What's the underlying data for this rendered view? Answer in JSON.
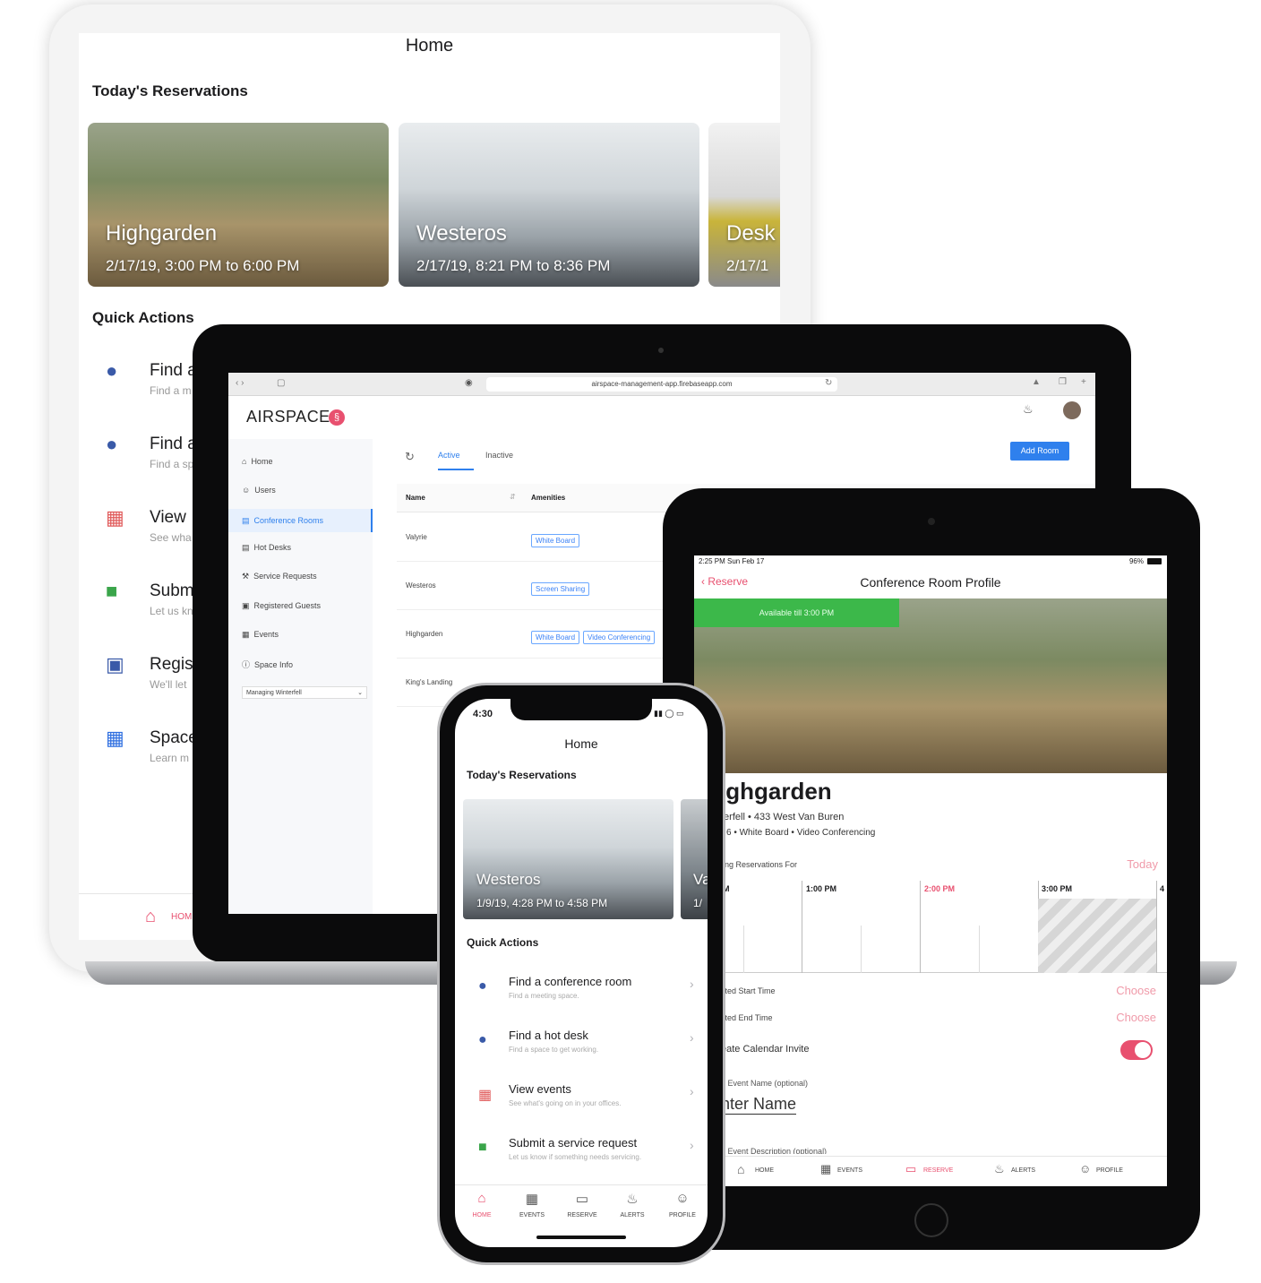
{
  "back_tablet": {
    "title": "Home",
    "reservations_heading": "Today's Reservations",
    "cards": [
      {
        "name": "Highgarden",
        "time": "2/17/19, 3:00 PM to 6:00 PM"
      },
      {
        "name": "Westeros",
        "time": "2/17/19, 8:21 PM to 8:36 PM"
      },
      {
        "name": "Desk",
        "time": "2/17/1"
      }
    ],
    "quick_actions_heading": "Quick Actions",
    "quick_actions": [
      {
        "title": "Find a",
        "sub": "Find a m"
      },
      {
        "title": "Find a",
        "sub": "Find a sp"
      },
      {
        "title": "View",
        "sub": "See wha"
      },
      {
        "title": "Subm",
        "sub": "Let us kn"
      },
      {
        "title": "Regis",
        "sub": "We'll let"
      },
      {
        "title": "Space",
        "sub": "Learn m"
      }
    ],
    "tab_home": "HOM"
  },
  "laptop": {
    "url": "airspace-management-app.firebaseapp.com",
    "logo": "AIRSPACE",
    "nav": [
      "Home",
      "Users",
      "Conference Rooms",
      "Hot Desks",
      "Service Requests",
      "Registered Guests",
      "Events",
      "Space Info"
    ],
    "managing": "Managing Winterfell",
    "tabs": {
      "active": "Active",
      "inactive": "Inactive"
    },
    "add_room": "Add Room",
    "columns": {
      "name": "Name",
      "amenities": "Amenities"
    },
    "rows": [
      {
        "name": "Valyrie",
        "tags": [
          "White Board"
        ]
      },
      {
        "name": "Westeros",
        "tags": [
          "Screen Sharing"
        ]
      },
      {
        "name": "Highgarden",
        "tags": [
          "White Board",
          "Video Conferencing"
        ]
      },
      {
        "name": "King's Landing",
        "tags": []
      }
    ]
  },
  "ipad": {
    "status_time": "2:25 PM  Sun Feb 17",
    "battery": "96%",
    "back": "Reserve",
    "title": "Conference Room Profile",
    "availability": "Available till 3:00 PM",
    "room": "ighgarden",
    "address": "terfell • 433 West Van Buren",
    "amenities": "6 • White Board • Video Conferencing",
    "upcoming_label": "ing Reservations For",
    "today": "Today",
    "times": [
      "M",
      "1:00 PM",
      "2:00 PM",
      "3:00 PM",
      "4"
    ],
    "start_label": "cted Start Time",
    "end_label": "cted End Time",
    "choose": "Choose",
    "calendar_label": "eate Calendar Invite",
    "event_name_label": "d Event Name (optional)",
    "enter_name": "nter Name",
    "desc_label": "d Event Description (optional)",
    "tabs": [
      "HOME",
      "EVENTS",
      "RESERVE",
      "ALERTS",
      "PROFILE"
    ]
  },
  "phone": {
    "time": "4:30",
    "title": "Home",
    "reservations_heading": "Today's Reservations",
    "card": {
      "name": "Westeros",
      "time": "1/9/19, 4:28 PM to 4:58 PM"
    },
    "card2": {
      "name": "Va",
      "time": "1/"
    },
    "quick_actions_heading": "Quick Actions",
    "quick_actions": [
      {
        "title": "Find a conference room",
        "sub": "Find a meeting space."
      },
      {
        "title": "Find a hot desk",
        "sub": "Find a space to get working."
      },
      {
        "title": "View events",
        "sub": "See what's going on in your offices."
      },
      {
        "title": "Submit a service request",
        "sub": "Let us know if something needs servicing."
      }
    ],
    "tabs": [
      "HOME",
      "EVENTS",
      "RESERVE",
      "ALERTS",
      "PROFILE"
    ]
  },
  "colors": {
    "accent_pink": "#e8506f",
    "accent_blue": "#2f80ed",
    "available_green": "#3cb84a"
  }
}
